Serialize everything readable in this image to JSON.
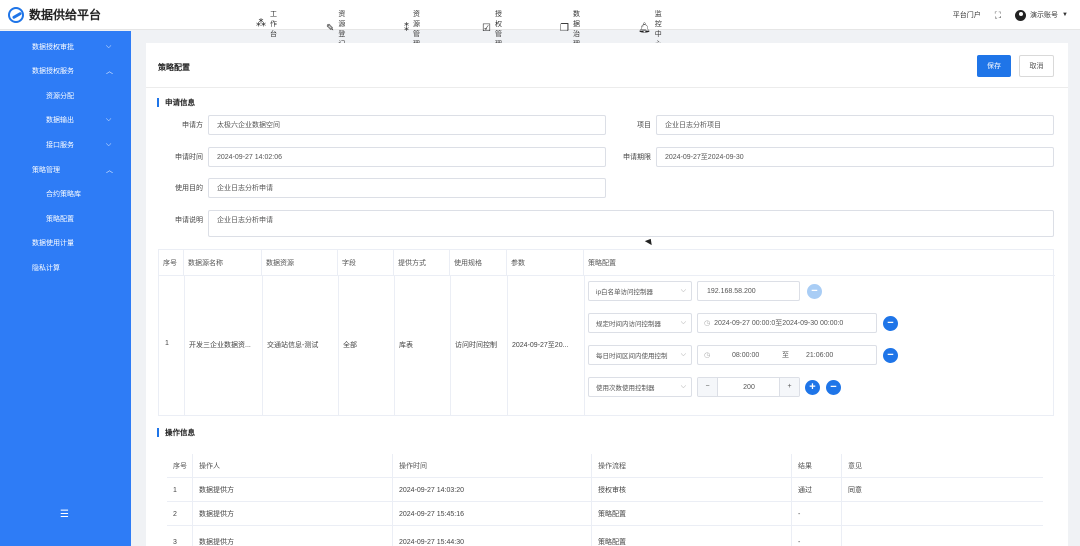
{
  "app": {
    "title": "数据供给平台"
  },
  "nav": [
    {
      "label": "工作台",
      "icon": "workbench-icon"
    },
    {
      "label": "资源登记",
      "icon": "pen-icon"
    },
    {
      "label": "资源管理",
      "icon": "resource-manage-icon"
    },
    {
      "label": "授权管理",
      "icon": "checkbox-icon"
    },
    {
      "label": "数据治理",
      "icon": "copy-icon"
    },
    {
      "label": "监控中心",
      "icon": "bell-icon"
    }
  ],
  "top_right": {
    "portal": "平台门户",
    "account": "演示账号"
  },
  "sidebar": {
    "items": [
      {
        "label": "数据授权审批",
        "chevron": "down"
      },
      {
        "label": "数据授权服务",
        "chevron": "up"
      },
      {
        "label": "资源分配",
        "chevron": ""
      },
      {
        "label": "数据输出",
        "chevron": "down"
      },
      {
        "label": "接口服务",
        "chevron": "down"
      },
      {
        "label": "策略管理",
        "chevron": "up"
      },
      {
        "label": "合约策略库",
        "chevron": ""
      },
      {
        "label": "策略配置",
        "chevron": ""
      },
      {
        "label": "数据使用计量",
        "chevron": ""
      },
      {
        "label": "隐私计算",
        "chevron": ""
      }
    ]
  },
  "page": {
    "title": "策略配置",
    "save_label": "保存",
    "cancel_label": "取消"
  },
  "apply_info": {
    "section_title": "申请信息",
    "applicant_label": "申请方",
    "applicant": "太极六企业数据空间",
    "project_label": "项目",
    "project": "企业日志分析项目",
    "apply_time_label": "申请时间",
    "apply_time": "2024-09-27 14:02:06",
    "apply_period_label": "申请期限",
    "apply_period": "2024-09-27至2024-09-30",
    "purpose_label": "使用目的",
    "purpose": "企业日志分析申请",
    "desc_label": "申请说明",
    "desc": "企业日志分析申请"
  },
  "policy_table": {
    "headers": [
      "序号",
      "数据源名称",
      "数据资源",
      "字段",
      "提供方式",
      "使用规格",
      "参数",
      "策略配置"
    ],
    "row": {
      "index": "1",
      "source": "开发三企业数据资...",
      "resource": "交通站信息-测试",
      "field": "全部",
      "method": "库表",
      "spec": "访问时间控制",
      "params": "2024-09-27至20..."
    },
    "policies": [
      {
        "select": "ip白名单访问控制器",
        "value": "192.168.58.200"
      },
      {
        "select": "规定时间内访问控制器",
        "start": "2024-09-27 00:00:0",
        "sep": "至",
        "end": "2024-09-30 00:00:0"
      },
      {
        "select": "每日时间区间内使用控制",
        "start": "08:00:00",
        "sep": "至",
        "end": "21:06:00"
      },
      {
        "select": "使用次数使用控制器",
        "count": "200",
        "minus": "−",
        "plus": "+"
      }
    ]
  },
  "ops_info": {
    "section_title": "操作信息",
    "headers": [
      "序号",
      "操作人",
      "操作时间",
      "操作流程",
      "结果",
      "意见"
    ],
    "rows": [
      [
        "1",
        "数据提供方",
        "2024-09-27 14:03:20",
        "授权审核",
        "通过",
        "同意"
      ],
      [
        "2",
        "数据提供方",
        "2024-09-27 15:45:16",
        "策略配置",
        "-",
        ""
      ],
      [
        "3",
        "数据提供方",
        "2024-09-27 15:44:30",
        "策略配置",
        "-",
        ""
      ]
    ]
  },
  "colors": {
    "accent": "#1f75e8",
    "sidebar": "#2e7cf6"
  }
}
